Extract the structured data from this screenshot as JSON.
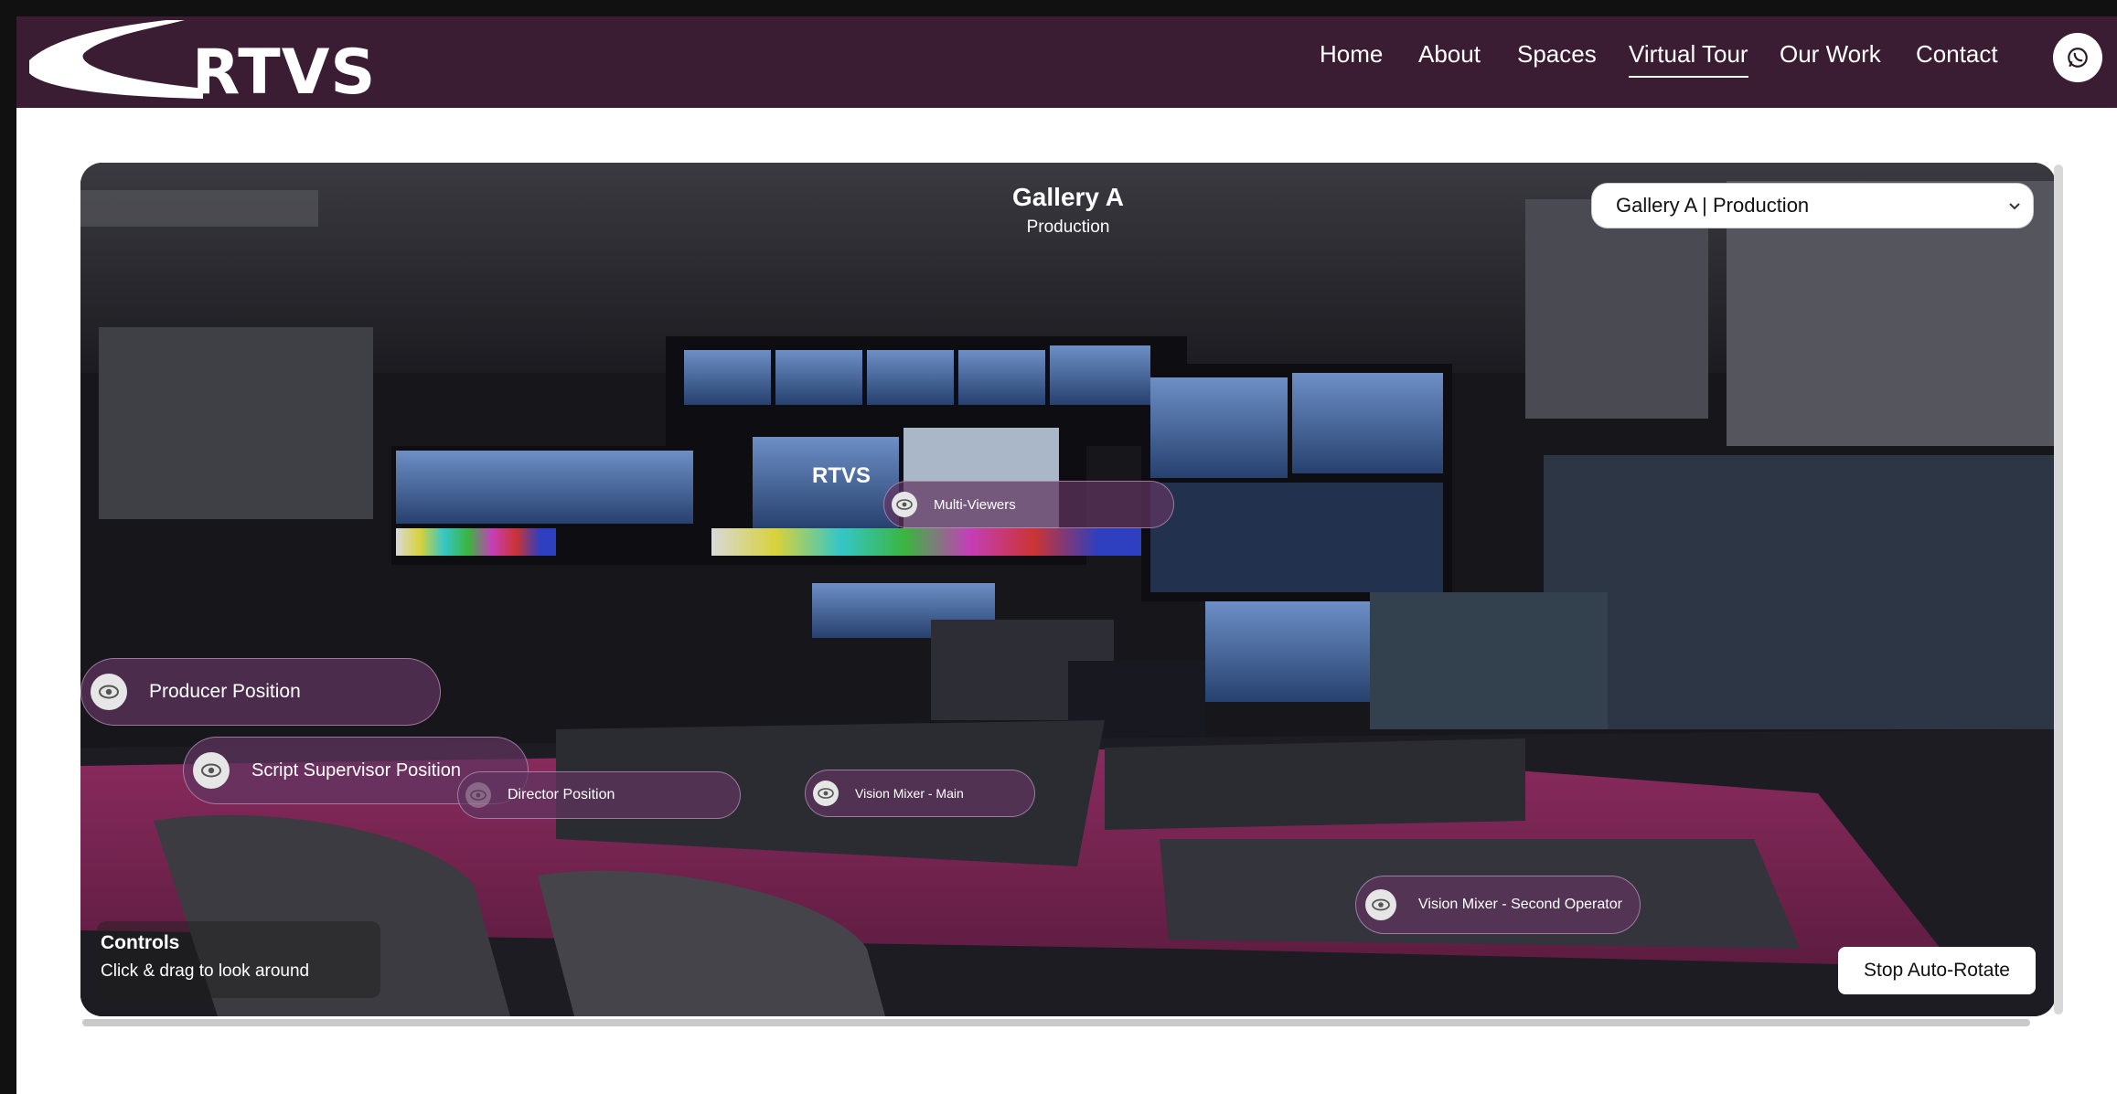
{
  "brand": {
    "logo_text": "RTVS"
  },
  "nav": {
    "items": [
      {
        "label": "Home",
        "active": false
      },
      {
        "label": "About",
        "active": false
      },
      {
        "label": "Spaces",
        "active": false
      },
      {
        "label": "Virtual Tour",
        "active": true
      },
      {
        "label": "Our Work",
        "active": false
      },
      {
        "label": "Contact",
        "active": false
      }
    ],
    "contact_icon": "whatsapp-icon"
  },
  "tour": {
    "title": "Gallery A",
    "subtitle": "Production",
    "select": {
      "value": "Gallery A | Production"
    },
    "screen_logo": "RTVS",
    "hotspots": [
      {
        "label": "Multi-Viewers"
      },
      {
        "label": "Producer Position"
      },
      {
        "label": "Script Supervisor Position"
      },
      {
        "label": "Director Position"
      },
      {
        "label": "Vision Mixer - Main"
      },
      {
        "label": "Vision Mixer - Second Operator"
      }
    ],
    "controls": {
      "title": "Controls",
      "hint": "Click & drag to look around"
    },
    "stop_button": "Stop Auto-Rotate"
  },
  "colors": {
    "nav_bg": "#3a1c33",
    "accent": "#7a2a57",
    "hotspot": "#603460"
  }
}
